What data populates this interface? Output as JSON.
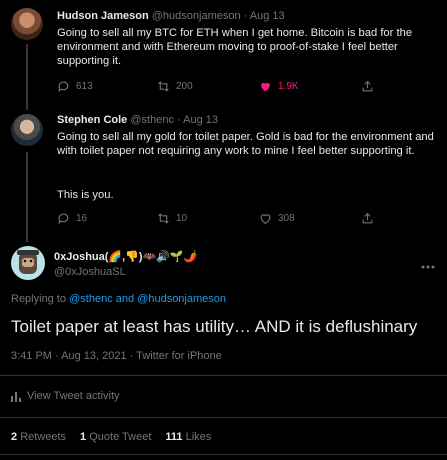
{
  "tweet1": {
    "name": "Hudson Jameson",
    "handle": "@hudsonjameson",
    "date": "· Aug 13",
    "text": "Going to sell all my BTC for ETH when I get home. Bitcoin is bad for the environment and with Ethereum moving to proof-of-stake I feel better supporting it.",
    "replies": "613",
    "retweets": "200",
    "likes": "1.9K"
  },
  "tweet2": {
    "name": "Stephen Cole",
    "handle": "@sthenc",
    "date": "· Aug 13",
    "text": "Going to sell all my gold for toilet paper. Gold is bad for the environment and with toilet paper not requiring any work to mine I feel better supporting it.",
    "text2": "This is you.",
    "replies": "16",
    "retweets": "10",
    "likes": "308"
  },
  "main": {
    "name": "0xJoshua(🌈,👎)🦇🔊🌱🌶️",
    "handle": "@0xJoshuaSL",
    "replying_label": "Replying to",
    "reply_handle1": "@sthenc",
    "reply_and": "and",
    "reply_handle2": "@hudsonjameson",
    "text": "Toilet paper at least has utility… AND it is deflushinary",
    "meta": "3:41 PM · Aug 13, 2021 · Twitter for iPhone",
    "activity_label": "View Tweet activity",
    "retweets_count": "2",
    "retweets_label": "Retweets",
    "quotes_count": "1",
    "quotes_label": "Quote Tweet",
    "likes_count": "111",
    "likes_label": "Likes"
  },
  "colors": {
    "background": "#000000",
    "text": "#e7e9ea",
    "muted": "#71767b",
    "link": "#1d9bf0",
    "like": "#f91880"
  }
}
